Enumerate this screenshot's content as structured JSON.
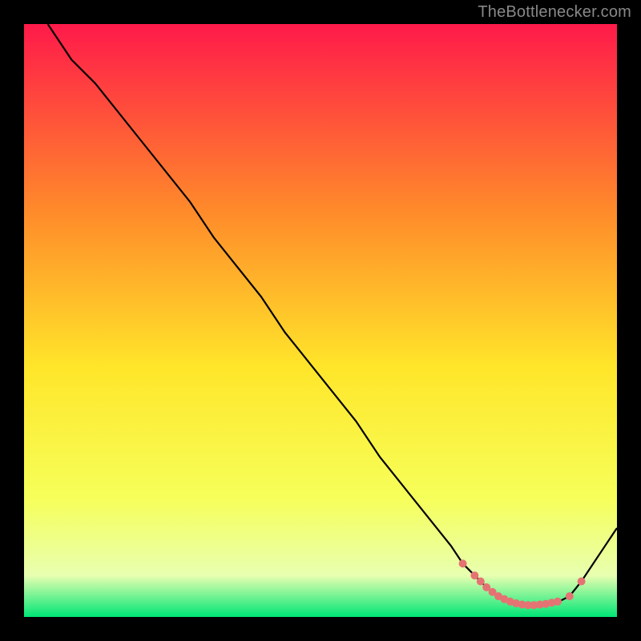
{
  "watermark": "TheBottlenecker.com",
  "gradient": {
    "top": "#ff1a4a",
    "upper_mid": "#ff8c2a",
    "mid": "#ffe62a",
    "lower_mid": "#f6ff5a",
    "near_bottom": "#e8ffb0",
    "bottom": "#00e676"
  },
  "chart_data": {
    "type": "line",
    "title": "",
    "xlabel": "",
    "ylabel": "",
    "xlim": [
      0,
      100
    ],
    "ylim": [
      0,
      100
    ],
    "grid": false,
    "legend": false,
    "series": [
      {
        "name": "bottleneck-curve",
        "color": "#000000",
        "x": [
          4,
          8,
          12,
          16,
          20,
          24,
          28,
          32,
          36,
          40,
          44,
          48,
          52,
          56,
          60,
          64,
          68,
          72,
          74,
          76,
          78,
          80,
          82,
          84,
          86,
          88,
          90,
          92,
          94,
          96,
          98,
          100
        ],
        "y": [
          100,
          94,
          90,
          85,
          80,
          75,
          70,
          64,
          59,
          54,
          48,
          43,
          38,
          33,
          27,
          22,
          17,
          12,
          9,
          7,
          5,
          3.5,
          2.5,
          2,
          2,
          2,
          2.5,
          3.5,
          6,
          9,
          12,
          15
        ]
      }
    ],
    "markers": {
      "name": "highlight-dots",
      "color": "#e57373",
      "radius": 5,
      "x": [
        74,
        76,
        77,
        78,
        79,
        80,
        81,
        82,
        83,
        84,
        85,
        86,
        87,
        88,
        89,
        90,
        92,
        94
      ],
      "y": [
        9,
        7,
        6,
        5,
        4.2,
        3.5,
        3,
        2.6,
        2.3,
        2.1,
        2,
        2,
        2.1,
        2.2,
        2.4,
        2.6,
        3.5,
        6
      ]
    }
  }
}
